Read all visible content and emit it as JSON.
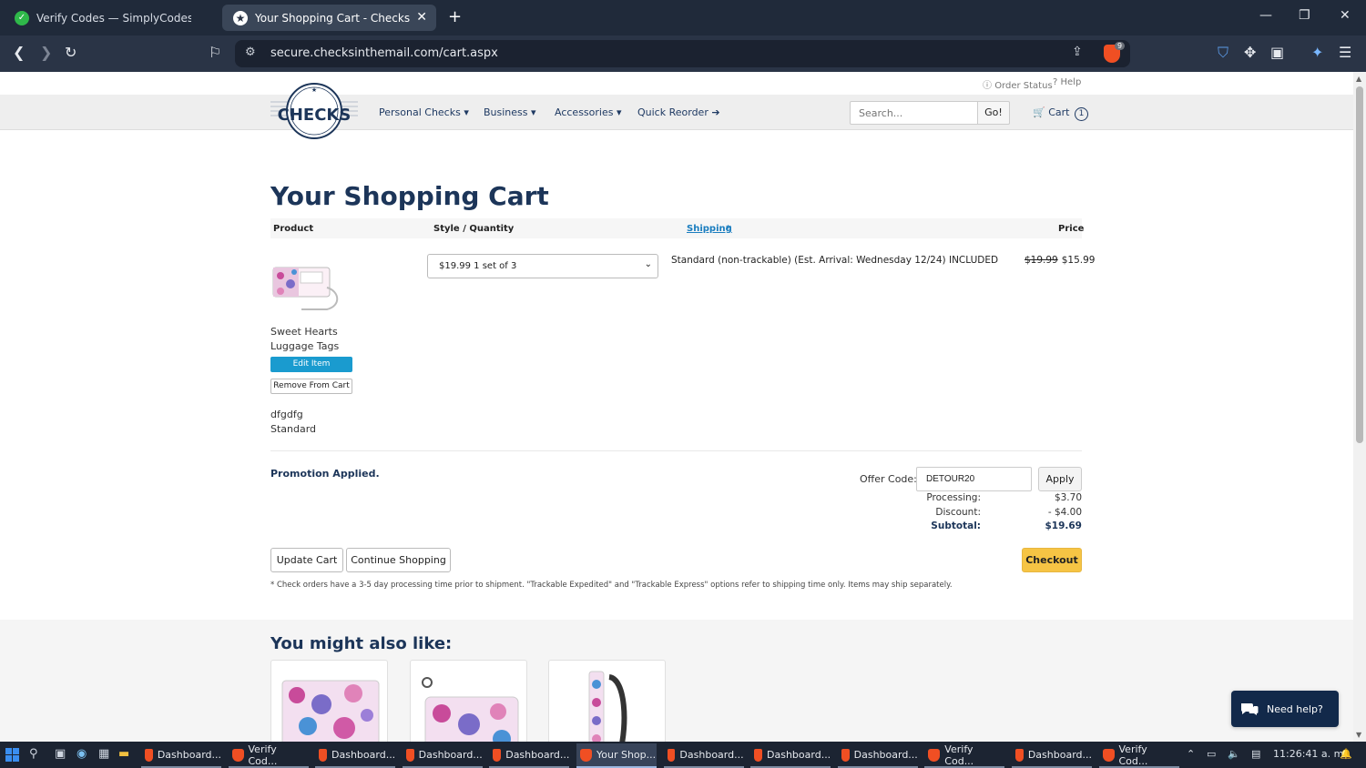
{
  "browser": {
    "tabs": [
      {
        "label": "Verify Codes — SimplyCodes",
        "active": false
      },
      {
        "label": "Your Shopping Cart - Checks In T",
        "active": true
      }
    ],
    "url": "secure.checksinthemail.com/cart.aspx",
    "brave_badge": "9"
  },
  "site": {
    "top_links": {
      "order_status": "Order Status",
      "help": "Help"
    },
    "nav": {
      "personal": "Personal Checks ▾",
      "business": "Business ▾",
      "accessories": "Accessories ▾",
      "quick_reorder": "Quick Reorder ➔"
    },
    "search": {
      "placeholder": "Search...",
      "go": "Go!"
    },
    "cart": {
      "label": "Cart",
      "count": "1"
    }
  },
  "cart": {
    "title": "Your Shopping Cart",
    "headers": {
      "product": "Product",
      "style_qty": "Style / Quantity",
      "shipping": "Shipping",
      "shipping_star": "*",
      "price": "Price"
    },
    "item": {
      "name": "Sweet Hearts Luggage Tags",
      "edit": "Edit Item",
      "remove": "Remove From Cart",
      "note1": "dfgdfg",
      "note2": "Standard",
      "style_selected": "$19.99 1 set of 3",
      "shipping": "Standard (non-trackable) (Est. Arrival: Wednesday 12/24) INCLUDED",
      "old_price": "$19.99",
      "price": "$15.99"
    },
    "promo": "Promotion Applied.",
    "offer": {
      "label": "Offer Code:",
      "value": "DETOUR20",
      "apply": "Apply"
    },
    "summary": {
      "processing_label": "Processing:",
      "processing": "$3.70",
      "discount_label": "Discount:",
      "discount": "- $4.00",
      "subtotal_label": "Subtotal:",
      "subtotal": "$19.69"
    },
    "buttons": {
      "update": "Update Cart",
      "continue": "Continue Shopping",
      "checkout": "Checkout"
    },
    "footnote": "* Check orders have a 3-5 day processing time prior to shipment. \"Trackable Expedited\" and \"Trackable Express\" options refer to shipping time only. Items may ship separately."
  },
  "recommendations": {
    "title": "You might also like:"
  },
  "help_chat": "Need help?",
  "taskbar": {
    "items": [
      "Dashboard...",
      "Verify Cod...",
      "Dashboard...",
      "Dashboard...",
      "Dashboard...",
      "Your Shop...",
      "Dashboard...",
      "Dashboard...",
      "Dashboard...",
      "Verify Cod...",
      "Dashboard...",
      "Verify Cod..."
    ],
    "active_index": 5,
    "time": "11:26:41 a. m."
  },
  "colors": {
    "brand_navy": "#1c3559",
    "accent_blue": "#1a9bcf",
    "checkout_yellow": "#f6c444"
  }
}
